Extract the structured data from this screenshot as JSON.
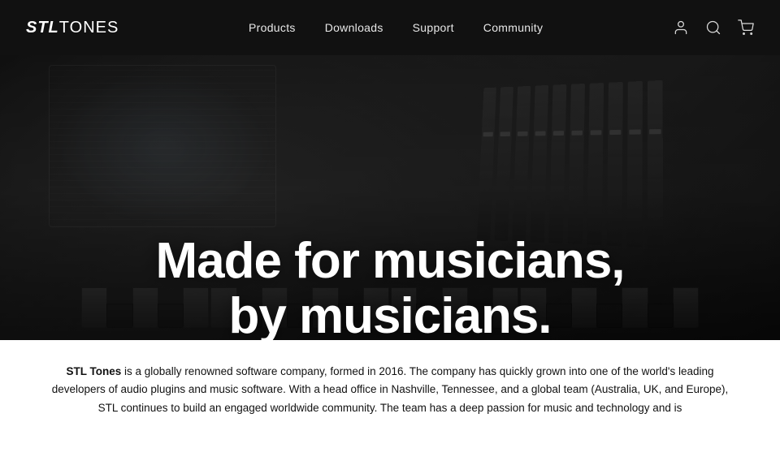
{
  "header": {
    "logo": {
      "stl": "STL",
      "tones": "TONES",
      "full": "STLTONES"
    },
    "nav": {
      "items": [
        {
          "id": "products",
          "label": "Products"
        },
        {
          "id": "downloads",
          "label": "Downloads"
        },
        {
          "id": "support",
          "label": "Support"
        },
        {
          "id": "community",
          "label": "Community"
        }
      ]
    },
    "icons": {
      "account": "account-icon",
      "search": "search-icon",
      "cart": "cart-icon"
    }
  },
  "hero": {
    "headline_line1": "Made for musicians,",
    "headline_line2": "by musicians."
  },
  "about": {
    "text": "STL Tones is a globally renowned software company, formed in 2016. The company has quickly grown into one of the world's leading developers of audio plugins and music software. With a head office in Nashville, Tennessee, and a global team (Australia, UK, and Europe), STL continues to build an engaged worldwide community. The team has a deep passion for music and technology and is"
  }
}
